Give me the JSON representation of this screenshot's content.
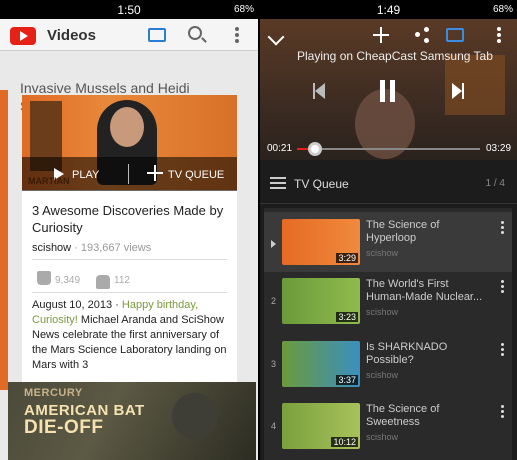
{
  "left": {
    "status": {
      "time": "1:50",
      "battery": "68%"
    },
    "appbar": {
      "title": "Videos"
    },
    "background_title": "Invasive Mussels and Heidi Sedivy:",
    "player_overlay": {
      "play_label": "PLAY",
      "queue_label": "TV QUEUE",
      "thumb_text": "MARTIAN"
    },
    "card": {
      "title": "3 Awesome Discoveries Made by Curiosity",
      "channel": "scishow",
      "views": " · 193,667 views",
      "likes": "9,349",
      "dislikes": "112",
      "date": "August 10, 2013 · ",
      "desc_highlight": "Happy birthday, Curiosity!",
      "desc_rest": " Michael Aranda and SciShow News celebrate the first anniversary of the Mars Science Laboratory landing on Mars with 3"
    },
    "bottom_thumb": {
      "line1": "MERCURY",
      "line2": "AMERICAN BAT",
      "line3": "DIE-OFF"
    }
  },
  "right": {
    "status": {
      "time": "1:49",
      "battery": "68%"
    },
    "player": {
      "playing_on": "Playing on CheapCast Samsung Tab",
      "time_current": "00:21",
      "time_total": "03:29",
      "progress_fraction": 0.1
    },
    "queue": {
      "title": "TV Queue",
      "count": "1 / 4",
      "items": [
        {
          "num": "",
          "title": "The Science of Hyperloop",
          "channel": "scishow",
          "duration": "3:29",
          "active": true
        },
        {
          "num": "2",
          "title": "The World's First Human-Made Nuclear...",
          "channel": "scishow",
          "duration": "3:23",
          "active": false
        },
        {
          "num": "3",
          "title": "Is SHARKNADO Possible?",
          "channel": "scishow",
          "duration": "3:37",
          "active": false
        },
        {
          "num": "4",
          "title": "The Science of Sweetness",
          "channel": "scishow",
          "duration": "10:12",
          "active": false
        }
      ]
    }
  },
  "colors": {
    "youtube_red": "#e62117",
    "cast_blue": "#3a8de3",
    "accent_green": "#7a9a3d"
  }
}
